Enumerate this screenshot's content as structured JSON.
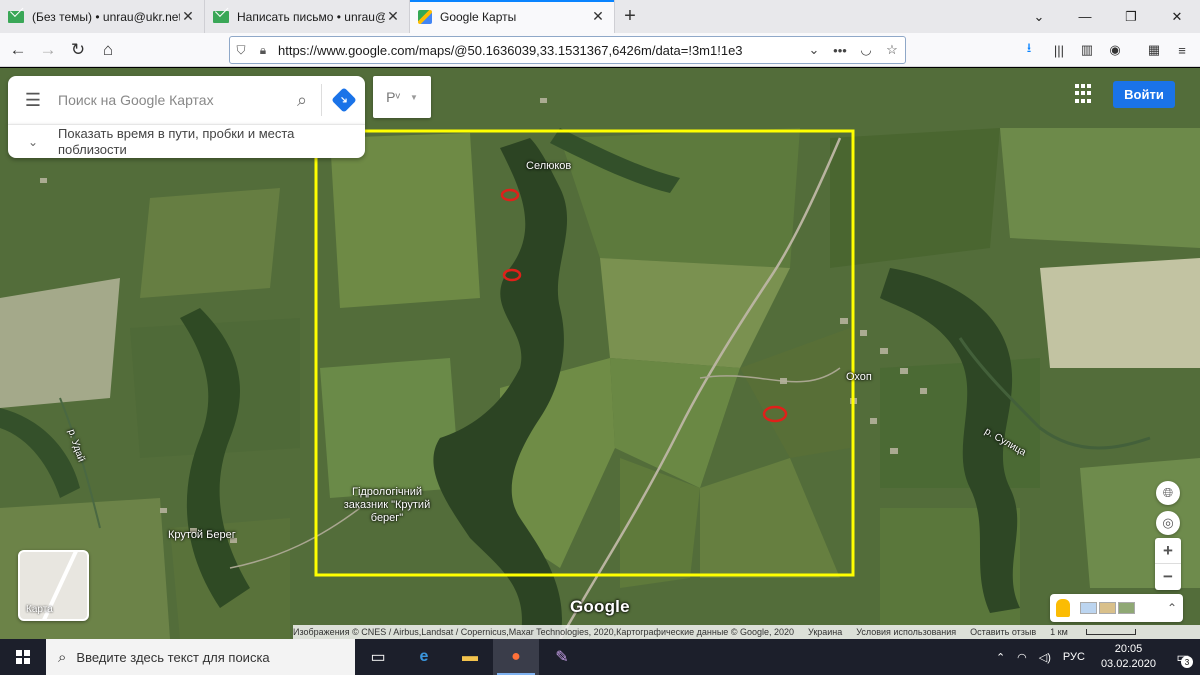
{
  "browser": {
    "tabs": [
      {
        "title": "(Без темы) • unrau@ukr.net",
        "icon": "mail-icon",
        "active": false
      },
      {
        "title": "Написать письмо • unrau@ukr.net",
        "icon": "mail-icon",
        "active": false
      },
      {
        "title": "Google Карты",
        "icon": "google-maps-icon",
        "active": true
      }
    ],
    "new_tab": "+",
    "url": "https://www.google.com/maps/@50.1636039,33.1531367,6426m/data=!3m1!1e3"
  },
  "maps": {
    "search_placeholder": "Поиск на Google Картах",
    "info_panel_text": "Показать время в пути, пробки и места поблизости",
    "lang_select": "Рᵛ",
    "signin_label": "Войти",
    "minimap_label": "Карта",
    "logo": "Google",
    "place_labels": {
      "selyukov": "Селюков",
      "okhop": "Охоп",
      "reserve": "Гідрологічний заказник \"Крутий берег\"",
      "kruтой_bereg": "Крутой Берег",
      "river_udai": "р. Удай",
      "river_sulitsa": "р. Сулица"
    },
    "attribution": {
      "imagery": "Изображения © CNES / Airbus,Landsat / Copernicus,Maxar Technologies, 2020,Картографические данные © Google, 2020",
      "country": "Украина",
      "terms": "Условия использования",
      "feedback": "Оставить отзыв",
      "scale": "1 км"
    },
    "colors": {
      "highlight_frame": "#ffff00",
      "marker": "#e0201a",
      "accent": "#1a73e8"
    }
  },
  "taskbar": {
    "search_placeholder": "Введите здесь текст для поиска",
    "language": "РУС",
    "time": "20:05",
    "date": "03.02.2020",
    "notifications": "3"
  }
}
